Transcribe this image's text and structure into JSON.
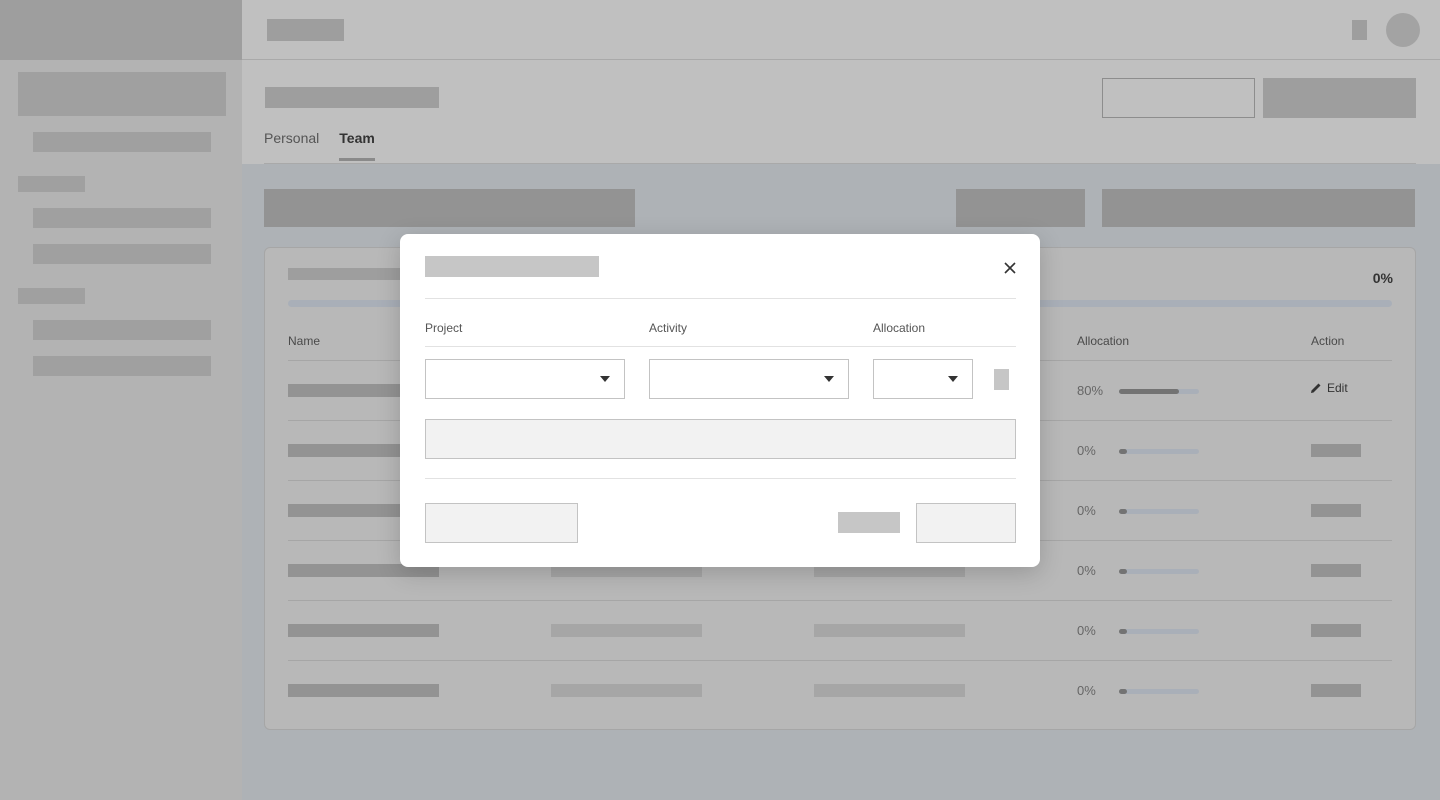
{
  "tabs": [
    {
      "label": "Personal",
      "active": false
    },
    {
      "label": "Team",
      "active": true
    }
  ],
  "progress": {
    "percent_label": "0%",
    "value": 0
  },
  "table": {
    "headers": {
      "name": "Name",
      "allocation": "Allocation",
      "action": "Action"
    },
    "rows": [
      {
        "allocation": "80%",
        "fill": 0.75,
        "action": "Edit"
      },
      {
        "allocation": "0%",
        "fill": 0.1,
        "action": ""
      },
      {
        "allocation": "0%",
        "fill": 0.1,
        "action": ""
      },
      {
        "allocation": "0%",
        "fill": 0.1,
        "action": ""
      },
      {
        "allocation": "0%",
        "fill": 0.1,
        "action": ""
      },
      {
        "allocation": "0%",
        "fill": 0.1,
        "action": ""
      }
    ]
  },
  "modal": {
    "labels": {
      "project": "Project",
      "activity": "Activity",
      "allocation": "Allocation"
    }
  },
  "icons": {
    "close": "close-icon",
    "edit": "pencil-icon",
    "caret": "caret-down-icon"
  },
  "colors": {
    "overlay": "#aeb2b6",
    "modal_bg": "#ffffff",
    "track": "#a9afb8"
  }
}
